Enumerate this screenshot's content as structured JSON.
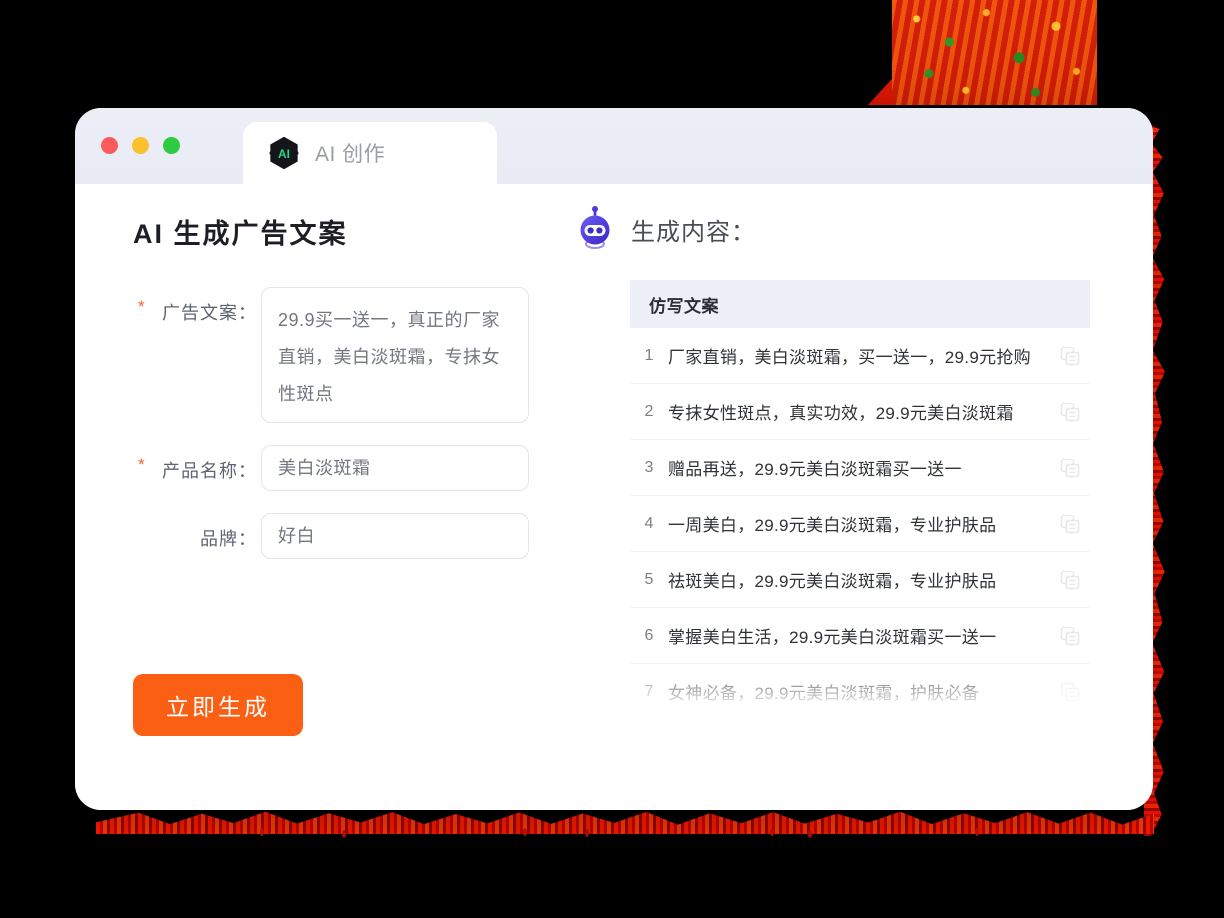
{
  "window": {
    "traffic_lights": [
      {
        "name": "close",
        "color": "#fb5b5f"
      },
      {
        "name": "minimize",
        "color": "#fcc02d"
      },
      {
        "name": "maximize",
        "color": "#2ecc40"
      }
    ],
    "tab": {
      "label": "AI 创作",
      "logo_icon": "ai-hexagon-logo-icon",
      "logo_text": "AI"
    }
  },
  "left_pane": {
    "title": "AI 生成广告文案",
    "fields": [
      {
        "label": "广告文案：",
        "required": true,
        "required_marker": "*",
        "type": "textarea",
        "value": "29.9买一送一，真正的厂家直销，美白淡斑霜，专抹女性斑点"
      },
      {
        "label": "产品名称：",
        "required": true,
        "required_marker": "*",
        "type": "input",
        "value": "美白淡斑霜"
      },
      {
        "label": "品牌：",
        "required": false,
        "required_marker": "",
        "type": "input",
        "value": "好白"
      }
    ],
    "submit_button": {
      "label": "立即生成",
      "color": "#fb5f14"
    }
  },
  "right_pane": {
    "heading": "生成内容：",
    "robot_icon": "robot-head-icon",
    "table": {
      "column_header": "仿写文案",
      "copy_icon": "copy-icon",
      "rows": [
        {
          "index": "1",
          "text": "厂家直销，美白淡斑霜，买一送一，29.9元抢购"
        },
        {
          "index": "2",
          "text": "专抹女性斑点，真实功效，29.9元美白淡斑霜"
        },
        {
          "index": "3",
          "text": "赠品再送，29.9元美白淡斑霜买一送一"
        },
        {
          "index": "4",
          "text": "一周美白，29.9元美白淡斑霜，专业护肤品"
        },
        {
          "index": "5",
          "text": "祛斑美白，29.9元美白淡斑霜，专业护肤品"
        },
        {
          "index": "6",
          "text": "掌握美白生活，29.9元美白淡斑霜买一送一"
        },
        {
          "index": "7",
          "text": "女神必备，29.9元美白淡斑霜，护肤必备"
        }
      ]
    }
  },
  "theme": {
    "accent_orange": "#fb5f14",
    "required_star": "#f4622c",
    "titlebar_bg": "#eceef6",
    "table_header_bg": "#edf0f8",
    "logo_green": "#24d97f",
    "robot_blue": "#4a3ad8",
    "decor_red": "#e02a09"
  }
}
